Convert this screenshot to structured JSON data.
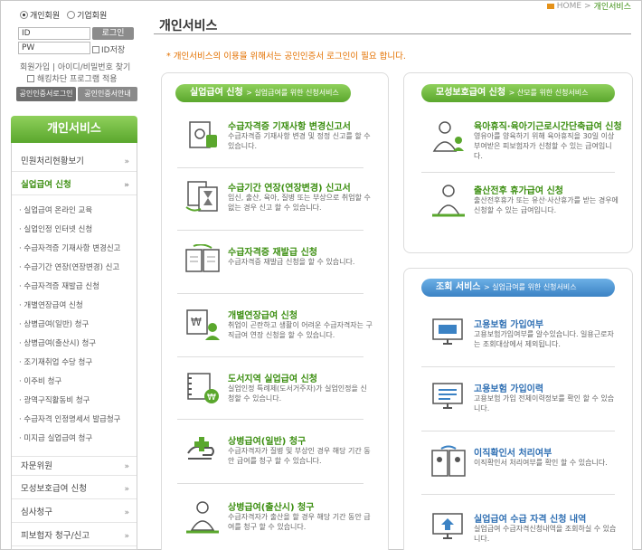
{
  "login": {
    "member_individual": "개인회원",
    "member_corporate": "기업회원",
    "id_placeholder": "ID",
    "pw_placeholder": "PW",
    "login_button": "로그인",
    "id_save": "ID저장",
    "links": "회원가입 | 아이디/비밀번호 찾기",
    "hacking_block": "해킹차단 프로그램 적용",
    "cert_login": "공인인증서로그인",
    "cert_guide": "공인인증서안내"
  },
  "sidebar": {
    "title": "개인서비스",
    "items": [
      {
        "label": "민원처리현황보기",
        "chev": "»"
      },
      {
        "label": "실업급여 신청",
        "chev": "»"
      },
      {
        "label": "자문위원",
        "chev": "»"
      },
      {
        "label": "모성보호급여 신청",
        "chev": "»"
      },
      {
        "label": "심사청구",
        "chev": "»"
      },
      {
        "label": "피보험자 청구/신고",
        "chev": "»"
      }
    ],
    "sub_items": [
      "· 실업급여 온라인 교육",
      "· 실업인정 인터넷 신청",
      "· 수급자격증 기재사항 변경신고",
      "· 수급기간 연장(연장변경) 신고",
      "· 수급자격증 재발급 신청",
      "· 개별연장급여 신청",
      "· 상병급여(일반) 청구",
      "· 상병급여(출산시) 청구",
      "· 조기재취업 수당 청구",
      "· 이주비 청구",
      "· 광역구직활동비 청구",
      "· 수급자격 인정명세서 발급청구",
      "· 미지급 실업급여 청구"
    ]
  },
  "breadcrumb": {
    "home": "HOME",
    "sep": ">",
    "current": "개인서비스"
  },
  "page_title": "개인서비스",
  "notice": "* 개인서비스의 이용을 위해서는 공인인증서 로그인이 필요 합니다.",
  "unemployment": {
    "title": "실업급여 신청",
    "subtitle": "> 실업급여를 위한 신청서비스",
    "services": [
      {
        "title": "수급자격증 기재사항 변경신고서",
        "desc": "수급자격증 기재사항 변경 및 정정 신고를 할 수 있습니다."
      },
      {
        "title": "수급기간 연장(연장변경) 신고서",
        "desc": "임신, 출산, 육아, 질병 또는 부상으로 취업할 수 없는 경우 신고 할 수 있습니다."
      },
      {
        "title": "수급자격증 재발급 신청",
        "desc": "수급자격증 재발급 신청을 할 수 있습니다."
      },
      {
        "title": "개별연장급여 신청",
        "desc": "취업이 곤란하고 생활이 어려운 수급자격자는 구직급여 연장 신청을 할 수 있습니다."
      },
      {
        "title": "도서지역 실업급여 신청",
        "desc": "실업인정 특례제(도서거주자)가 실업인정을 신청할 수 있습니다."
      },
      {
        "title": "상병급여(일반) 청구",
        "desc": "수급자격자가 질병 및 부상인 경우 해당 기간 동안 급여를 청구 할 수 있습니다."
      },
      {
        "title": "상병급여(출산시) 청구",
        "desc": "수급자격자가 출산을 할 경우 해당 기간 동안 급여를 청구 할 수 있습니다."
      }
    ]
  },
  "maternity": {
    "title": "모성보호급여 신청",
    "subtitle": "> 산모를 위한 신청서비스",
    "services": [
      {
        "title": "육아휴직·육아기근로시간단축급여 신청",
        "desc": "영유아를 양육하기 위해 육아휴직을 30일 이상 부여받은 피보험자가 신청할 수 있는 급여입니다."
      },
      {
        "title": "출산전후 휴가급여 신청",
        "desc": "출산전후휴가 또는 유산·사산휴가를 받는 경우에 신청할 수 있는 급여입니다."
      }
    ]
  },
  "inquiry": {
    "title": "조회 서비스",
    "subtitle": "> 실업급여를 위한 신청서비스",
    "services": [
      {
        "title": "고용보험 가입여부",
        "desc": "고용보험가입여부를 알수있습니다. 일용근로자는 조회대상에서 제외됩니다."
      },
      {
        "title": "고용보험 가입이력",
        "desc": "고용보험 가입 전체이력정보를 확인 할 수 있습니다."
      },
      {
        "title": "이직확인서 처리여부",
        "desc": "이직확인서 처리여부를 확인 할 수 있습니다."
      },
      {
        "title": "실업급여 수급 자격 신청 내역",
        "desc": "실업급여 수급자격신청내역을 조회하실 수 있습니다."
      }
    ]
  },
  "colors": {
    "green": "#5aa72d",
    "blue": "#3b82c4",
    "orange": "#e37100"
  }
}
